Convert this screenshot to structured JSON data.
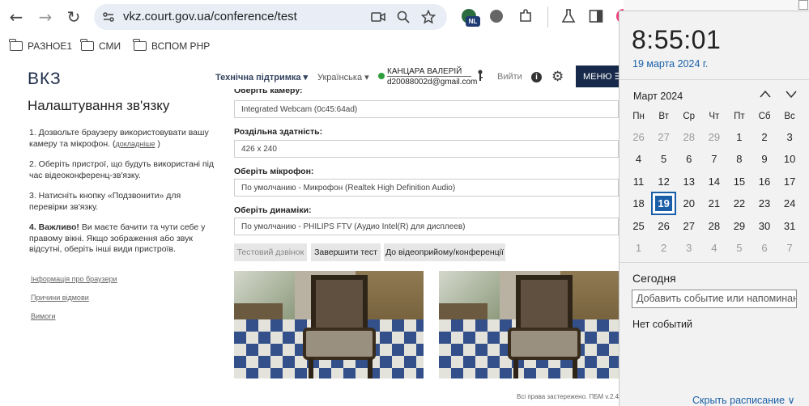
{
  "browser": {
    "url": "vkz.court.gov.ua/conference/test",
    "nav": {
      "back": "←",
      "forward": "→",
      "reload": "↻"
    },
    "bookmarks": [
      "РАЗНОЕ1",
      "СМИ",
      "ВСПОМ РНР"
    ],
    "profile_badge": "NL"
  },
  "site": {
    "logo": "ВКЗ",
    "support": "Технічна підтримка ▾",
    "language": "Українська ▾",
    "user_name": "КАНЦАРА ВАЛЕРІЙ",
    "user_email": "d20088002d@gmail.com",
    "logout": "Вийти",
    "menu": "МЕНЮ ☰"
  },
  "left": {
    "title": "Налаштування зв'язку",
    "step1": "1. Дозвольте браузеру використовувати вашу камеру та мікрофон. (",
    "step1_link": "докладніше",
    "step1_end": " )",
    "step2": "2. Оберіть пристрої, що будуть використані під час відеоконференц-зв'язку.",
    "step3": "3. Натисніть кнопку «Подзвонити» для перевірки зв'язку.",
    "step4_bold": "4. Важливо!",
    "step4": " Ви маєте бачити та чути себе у правому вікні. Якщо зображення або звук відсутні, оберіть інші види пристроїв.",
    "links": [
      "Інформація про браузери",
      "Причини відмови",
      "Вимоги"
    ]
  },
  "form": {
    "camera_label": "Оберіть камеру:",
    "camera_value": "Integrated Webcam (0c45:64ad)",
    "resolution_label": "Роздільна здатність:",
    "resolution_value": "426 x 240",
    "mic_label": "Оберіть мікрофон:",
    "mic_value": "По умолчанию - Микрофон (Realtek High Definition Audio)",
    "speaker_label": "Оберіть динаміки:",
    "speaker_value": "По умолчанию - PHILIPS FTV (Аудио Intel(R) для дисплеев)",
    "btn_test_call": "Тестовий дзвінок",
    "btn_finish": "Завершити тест",
    "btn_to_room": "До відеоприйому/конференції"
  },
  "footer": "Всі права застережено. ПБМ v.2.4",
  "calendar": {
    "time": "8:55:01",
    "date": "19 марта 2024 г.",
    "month": "Март 2024",
    "weekdays": [
      "Пн",
      "Вт",
      "Ср",
      "Чт",
      "Пт",
      "Сб",
      "Вс"
    ],
    "weeks": [
      [
        "26",
        "27",
        "28",
        "29",
        "1",
        "2",
        "3"
      ],
      [
        "4",
        "5",
        "6",
        "7",
        "8",
        "9",
        "10"
      ],
      [
        "11",
        "12",
        "13",
        "14",
        "15",
        "16",
        "17"
      ],
      [
        "18",
        "19",
        "20",
        "21",
        "22",
        "23",
        "24"
      ],
      [
        "25",
        "26",
        "27",
        "28",
        "29",
        "30",
        "31"
      ],
      [
        "1",
        "2",
        "3",
        "4",
        "5",
        "6",
        "7"
      ]
    ],
    "today_label": "Сегодня",
    "event_placeholder": "Добавить событие или напоминание",
    "no_events": "Нет событий",
    "hide_schedule": "Скрыть расписание ∨"
  }
}
